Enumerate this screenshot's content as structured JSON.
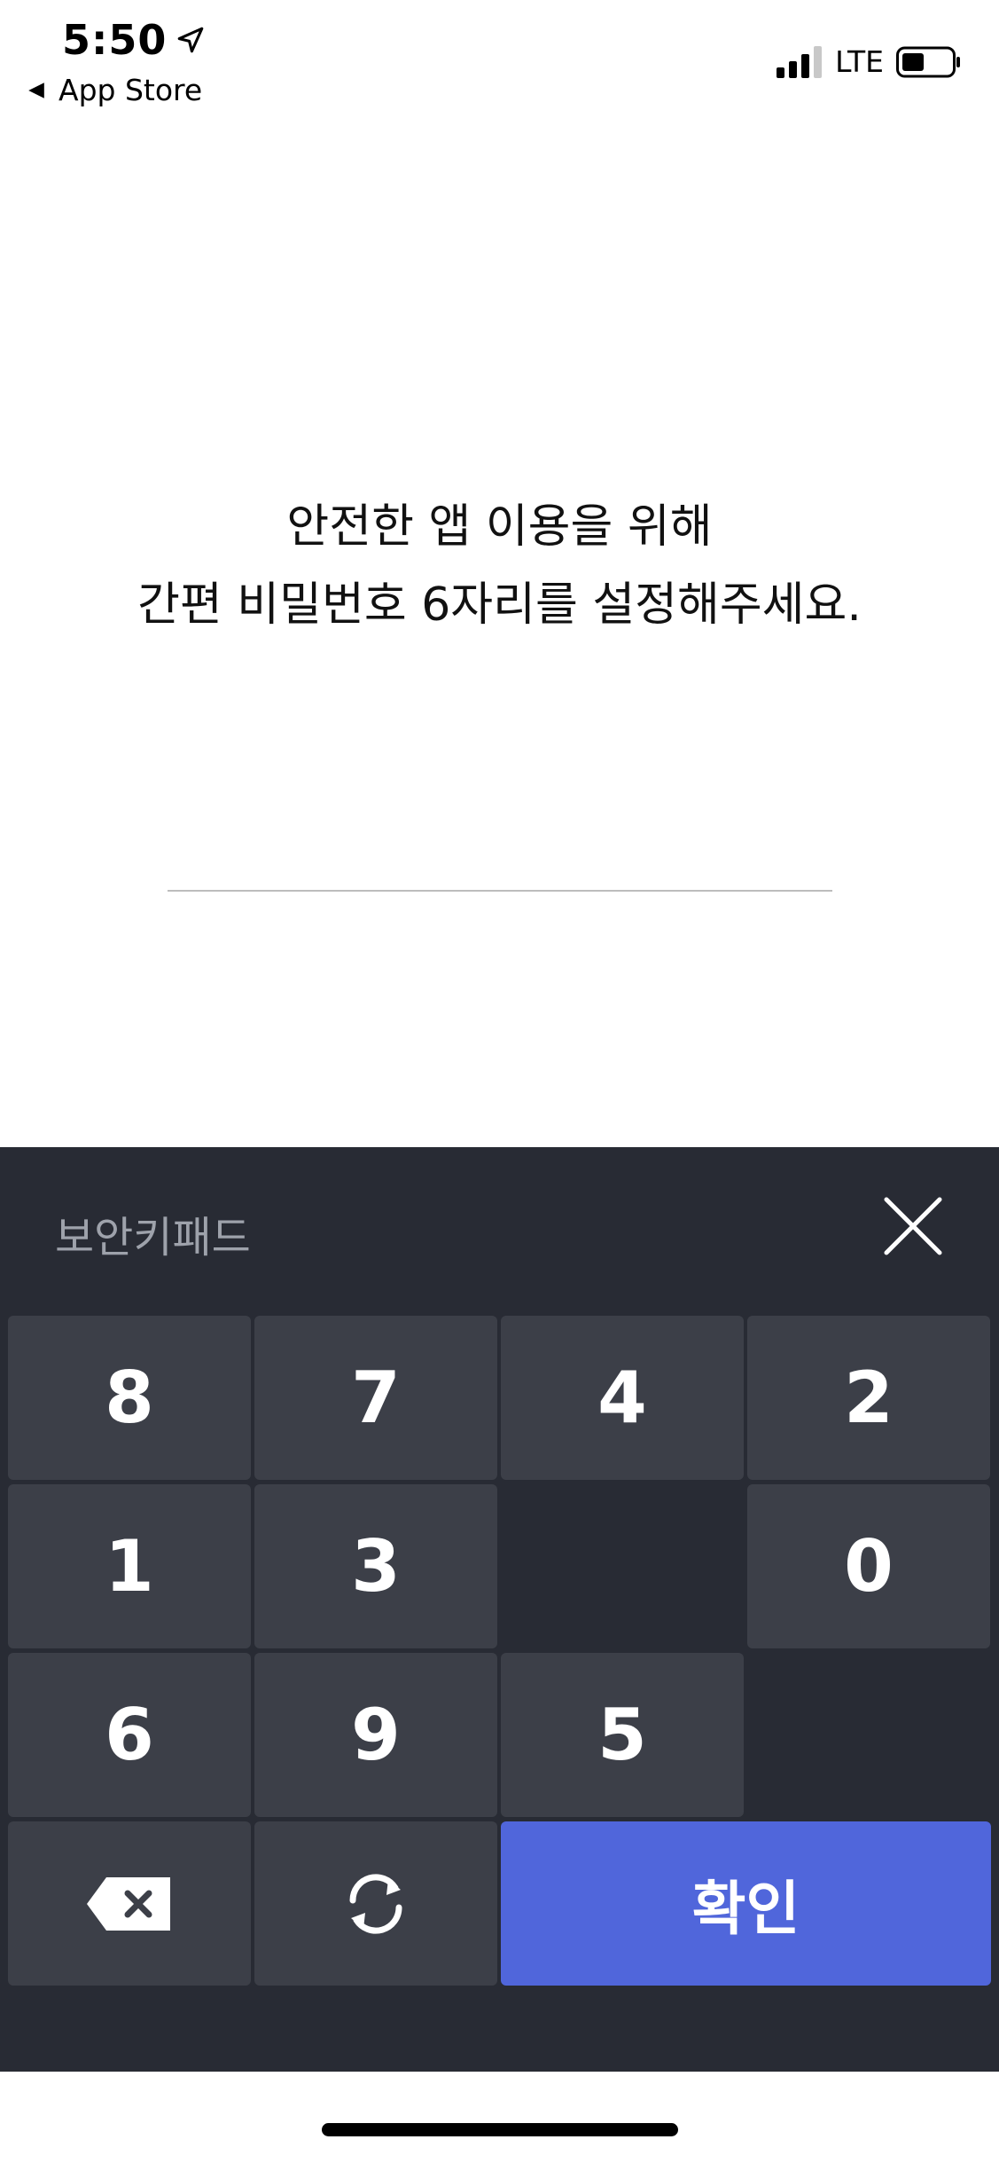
{
  "status_bar": {
    "time": "5:50",
    "back_label": "App Store",
    "network": "LTE",
    "icons": [
      "location-arrow-icon",
      "signal-bars-icon",
      "battery-icon"
    ]
  },
  "prompt": {
    "line1": "안전한 앱 이용을 위해",
    "line2": "간편 비밀번호 6자리를 설정해주세요."
  },
  "keypad": {
    "title": "보안키패드",
    "close_icon": "close-icon",
    "rows": [
      [
        "8",
        "7",
        "4",
        "2"
      ],
      [
        "1",
        "3",
        "",
        "0"
      ],
      [
        "6",
        "9",
        "5",
        ""
      ]
    ],
    "backspace_icon": "backspace-icon",
    "shuffle_icon": "refresh-icon",
    "confirm_label": "확인"
  },
  "colors": {
    "keypad_bg": "#282b34",
    "key_bg": "#3c3f48",
    "confirm_bg": "#5066db",
    "title_color": "#9ea2ab"
  }
}
